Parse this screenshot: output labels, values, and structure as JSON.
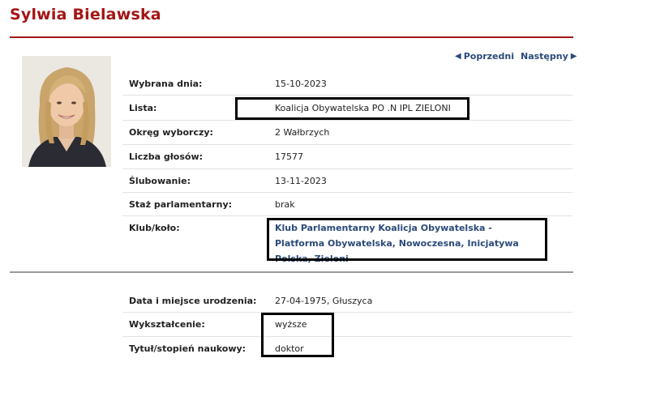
{
  "header": {
    "name": "Sylwia Bielawska"
  },
  "nav": {
    "prev_label": "Poprzedni",
    "next_label": "Następny"
  },
  "details": {
    "wybrana_dnia": {
      "label": "Wybrana dnia:",
      "value": "15-10-2023"
    },
    "lista": {
      "label": "Lista:",
      "value": "Koalicja Obywatelska PO .N IPL ZIELONI"
    },
    "okreg": {
      "label": "Okręg wyborczy:",
      "value": "2  Wałbrzych"
    },
    "glosy": {
      "label": "Liczba głosów:",
      "value": "17577"
    },
    "slubowanie": {
      "label": "Ślubowanie:",
      "value": "13-11-2023"
    },
    "staz": {
      "label": "Staż parlamentarny:",
      "value": "brak"
    },
    "klub": {
      "label": "Klub/koło:",
      "value": "Klub Parlamentarny Koalicja Obywatelska - Platforma Obywatelska, Nowoczesna, Inicjatywa Polska, Zieloni"
    }
  },
  "personal": {
    "urodzenie": {
      "label": "Data i miejsce urodzenia:",
      "value": "27-04-1975, Głuszyca"
    },
    "wyksztalcenie": {
      "label": "Wykształcenie:",
      "value": "wyższe"
    },
    "tytul": {
      "label": "Tytuł/stopień naukowy:",
      "value": "doktor"
    }
  },
  "colors": {
    "accent": "#a31515",
    "link": "#2b4a7a",
    "highlight_box": "#000000"
  },
  "icons": {
    "prev": "triangle-left-icon",
    "next": "triangle-right-icon"
  }
}
